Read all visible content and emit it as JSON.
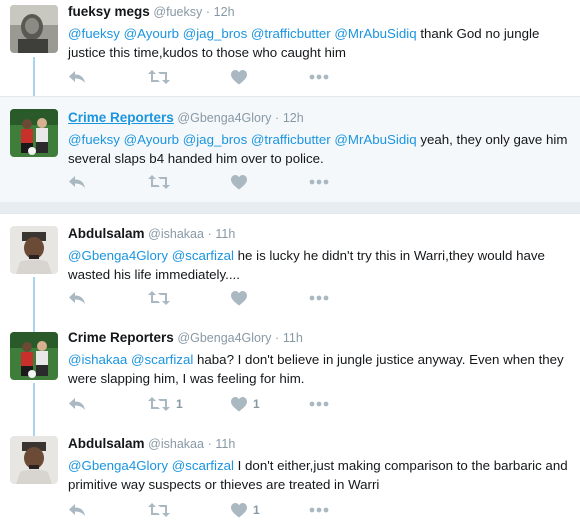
{
  "tweets": [
    {
      "name": "fueksy megs",
      "handle": "@fueksy",
      "dot": "·",
      "time": "12h",
      "segments": [
        {
          "t": "@fueksy ",
          "m": true
        },
        {
          "t": "@Ayourb ",
          "m": true
        },
        {
          "t": "@jag_bros ",
          "m": true
        },
        {
          "t": "@trafficbutter ",
          "m": true
        },
        {
          "t": "@MrAbuSidiq",
          "m": true
        },
        {
          "t": " thank God no jungle justice this time,kudos to those who caught him",
          "m": false
        }
      ],
      "retweets": "",
      "likes": ""
    },
    {
      "name": "Crime Reporters",
      "handle": "@Gbenga4Glory",
      "dot": "·",
      "time": "12h",
      "segments": [
        {
          "t": "@fueksy ",
          "m": true
        },
        {
          "t": "@Ayourb ",
          "m": true
        },
        {
          "t": "@jag_bros ",
          "m": true
        },
        {
          "t": "@trafficbutter ",
          "m": true
        },
        {
          "t": "@MrAbuSidiq",
          "m": true
        },
        {
          "t": " yeah, they only gave him several slaps b4 handed him over to police.",
          "m": false
        }
      ],
      "retweets": "",
      "likes": ""
    },
    {
      "name": "Abdulsalam",
      "handle": "@ishakaa",
      "dot": "·",
      "time": "11h",
      "segments": [
        {
          "t": "@Gbenga4Glory ",
          "m": true
        },
        {
          "t": "@scarfizal",
          "m": true
        },
        {
          "t": " he is lucky he didn't try this in Warri,they would have wasted his life immediately....",
          "m": false
        }
      ],
      "retweets": "",
      "likes": ""
    },
    {
      "name": "Crime Reporters",
      "handle": "@Gbenga4Glory",
      "dot": "·",
      "time": "11h",
      "segments": [
        {
          "t": "@ishakaa ",
          "m": true
        },
        {
          "t": "@scarfizal",
          "m": true
        },
        {
          "t": " haba? I don't believe in jungle justice anyway. Even when they were slapping him, I was feeling for him.",
          "m": false
        }
      ],
      "retweets": "1",
      "likes": "1"
    },
    {
      "name": "Abdulsalam",
      "handle": "@ishakaa",
      "dot": "·",
      "time": "11h",
      "segments": [
        {
          "t": "@Gbenga4Glory ",
          "m": true
        },
        {
          "t": "@scarfizal",
          "m": true
        },
        {
          "t": " I don't either,just making comparison to the barbaric and primitive way suspects or thieves are treated in Warri",
          "m": false
        }
      ],
      "retweets": "",
      "likes": "1"
    }
  ],
  "icons": {
    "reply": "reply-icon",
    "retweet": "retweet-icon",
    "like": "heart-icon",
    "more": "more-icon"
  },
  "colors": {
    "link": "#1b95e0",
    "muted": "#8899a6",
    "icon": "#aab8c2",
    "thread_line": "#a8d4ef",
    "highlight_bg": "#f5f8fa"
  }
}
